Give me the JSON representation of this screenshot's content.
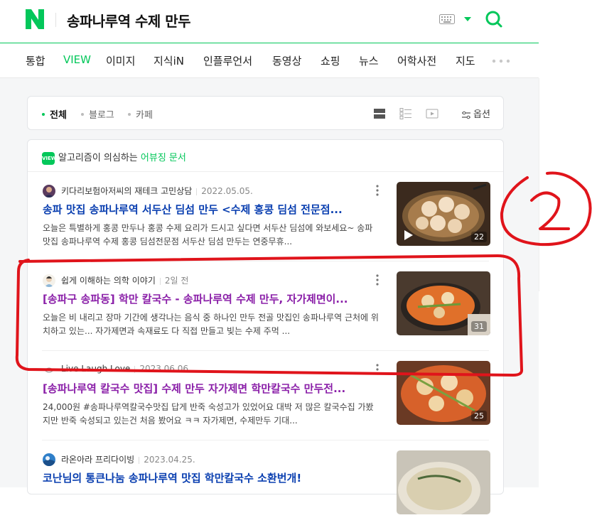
{
  "header": {
    "query": "송파나루역 수제 만두",
    "colors": {
      "brand": "#03c75a"
    }
  },
  "tabs": [
    {
      "label": "통합",
      "active": false
    },
    {
      "label": "VIEW",
      "active": true
    },
    {
      "label": "이미지",
      "active": false
    },
    {
      "label": "지식iN",
      "active": false
    },
    {
      "label": "인플루언서",
      "active": false
    },
    {
      "label": "동영상",
      "active": false
    },
    {
      "label": "쇼핑",
      "active": false
    },
    {
      "label": "뉴스",
      "active": false
    },
    {
      "label": "어학사전",
      "active": false
    },
    {
      "label": "지도",
      "active": false
    }
  ],
  "filters": {
    "all": "전체",
    "blog": "블로그",
    "cafe": "카페",
    "options": "옵션"
  },
  "notice": {
    "badge": "VIEW",
    "text": "알고리즘이 의심하는 ",
    "link": "어뷰징 문서"
  },
  "results": [
    {
      "author": "키다리보험아저씨의 재테크 고민상담",
      "date": "2022.05.05.",
      "title": "송파 맛집 송파나루역 서두산 딤섬 만두 <수제 홍콩 딤섬 전문점...",
      "desc": "오늘은 특별하게 홍콩 만두나 홍콩 수제 요리가 드시고 싶다면 서두산 딤섬에 와보세요~ 송파 맛집 송파나루역 수제 홍콩 딤섬전문점 서두산 딤섬 만두는 연중무휴...",
      "count": "22",
      "visited": false,
      "video": true
    },
    {
      "author": "쉽게 이해하는 의학 이야기",
      "date": "2일 전",
      "title": "[송파구 송파동] 학만 칼국수 - 송파나루역 수제 만두, 자가제면이...",
      "desc": "오늘은 비 내리고 장마 기간에 생각나는 음식 중 하나인 만두 전골 맛집인 송파나루역 근처에 위치하고 있는... 자가제면과 속재료도 다 직접 만들고 빚는 수제 주먹 ...",
      "count": "31",
      "visited": true,
      "video": false
    },
    {
      "author": "Live Laugh Love",
      "date": "2023.06.06.",
      "title": "[송파나루역 칼국수 맛집] 수제 만두 자가제면 학만칼국수 만두전...",
      "desc": "24,000원 #송파나루역칼국수맛집 답게 반죽 숙성고가 있었어요 대박 저 많은 칼국수집 가봤지만 반죽 숙성되고 있는건 처음 봤어요 ㅋㅋ 자가제면, 수제만두 기대...",
      "count": "25",
      "visited": true,
      "video": false
    },
    {
      "author": "라온아라 프리다이빙",
      "date": "2023.04.25.",
      "title": "코난님의 통큰나눔 송파나루역 맛집 학만칼국수 소환번개!",
      "desc": "",
      "count": "",
      "visited": false,
      "video": false
    }
  ],
  "annotation": {
    "mark": "②",
    "color": "#e0141b"
  }
}
